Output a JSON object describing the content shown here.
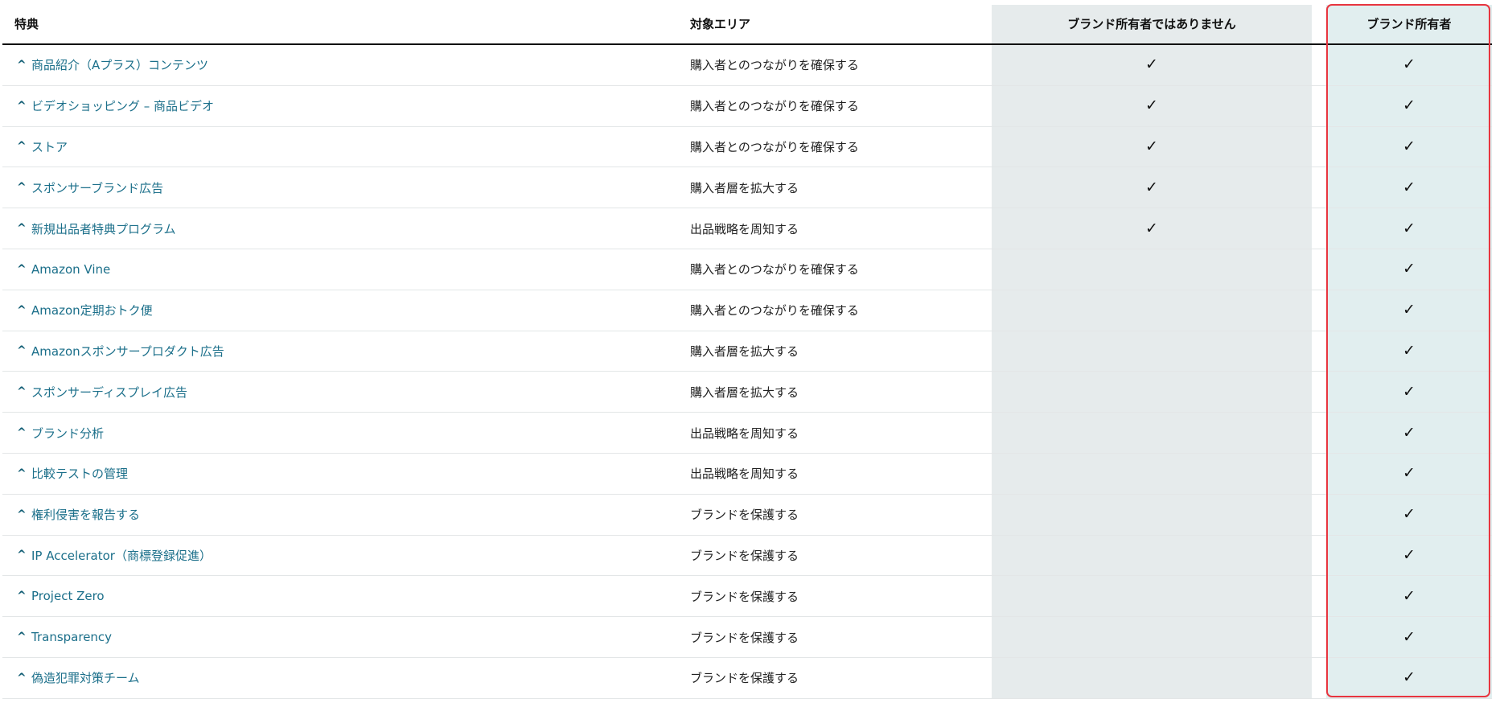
{
  "header": {
    "benefit": "特典",
    "area": "対象エリア",
    "non_owner": "ブランド所有者ではありません",
    "owner": "ブランド所有者"
  },
  "icons": {
    "expand": "caret-up-icon",
    "check": "checkmark-icon",
    "check_glyph": "✓",
    "caret_glyph": "^"
  },
  "colors": {
    "link": "#1b6f8a",
    "non_owner_band": "#e6ebec",
    "owner_band": "#e1eeef",
    "highlight_border": "#e8353f"
  },
  "rows": [
    {
      "benefit": "商品紹介（Aプラス）コンテンツ",
      "area": "購入者とのつながりを確保する",
      "non_owner": true,
      "owner": true
    },
    {
      "benefit": "ビデオショッピング – 商品ビデオ",
      "area": "購入者とのつながりを確保する",
      "non_owner": true,
      "owner": true
    },
    {
      "benefit": "ストア",
      "area": "購入者とのつながりを確保する",
      "non_owner": true,
      "owner": true
    },
    {
      "benefit": "スポンサーブランド広告",
      "area": "購入者層を拡大する",
      "non_owner": true,
      "owner": true
    },
    {
      "benefit": "新規出品者特典プログラム",
      "area": "出品戦略を周知する",
      "non_owner": true,
      "owner": true
    },
    {
      "benefit": "Amazon Vine",
      "area": "購入者とのつながりを確保する",
      "non_owner": false,
      "owner": true
    },
    {
      "benefit": "Amazon定期おトク便",
      "area": "購入者とのつながりを確保する",
      "non_owner": false,
      "owner": true
    },
    {
      "benefit": "Amazonスポンサープロダクト広告",
      "area": "購入者層を拡大する",
      "non_owner": false,
      "owner": true
    },
    {
      "benefit": "スポンサーディスプレイ広告",
      "area": "購入者層を拡大する",
      "non_owner": false,
      "owner": true
    },
    {
      "benefit": "ブランド分析",
      "area": "出品戦略を周知する",
      "non_owner": false,
      "owner": true
    },
    {
      "benefit": "比較テストの管理",
      "area": "出品戦略を周知する",
      "non_owner": false,
      "owner": true
    },
    {
      "benefit": "権利侵害を報告する",
      "area": "ブランドを保護する",
      "non_owner": false,
      "owner": true
    },
    {
      "benefit": "IP Accelerator（商標登録促進）",
      "area": "ブランドを保護する",
      "non_owner": false,
      "owner": true
    },
    {
      "benefit": "Project Zero",
      "area": "ブランドを保護する",
      "non_owner": false,
      "owner": true
    },
    {
      "benefit": "Transparency",
      "area": "ブランドを保護する",
      "non_owner": false,
      "owner": true
    },
    {
      "benefit": "偽造犯罪対策チーム",
      "area": "ブランドを保護する",
      "non_owner": false,
      "owner": true
    }
  ]
}
